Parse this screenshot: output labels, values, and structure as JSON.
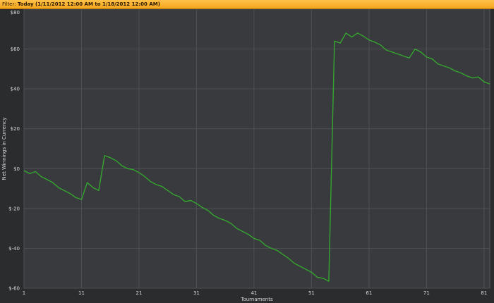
{
  "filter": {
    "label": "Filter:",
    "value": "Today (1/11/2012 12:00 AM to 1/18/2012 12:00 AM)"
  },
  "colors": {
    "plot_bg": "#383a3d",
    "grid": "#4d5054",
    "line": "#35a52f",
    "accent": "#f4a51e"
  },
  "chart_data": {
    "type": "line",
    "title": "",
    "xlabel": "Tournaments",
    "ylabel": "Net Winnings in Currency",
    "xlim": [
      1,
      82
    ],
    "ylim": [
      -60,
      80
    ],
    "x_ticks": [
      1,
      11,
      21,
      31,
      41,
      51,
      61,
      71,
      81
    ],
    "y_ticks": [
      80,
      60,
      40,
      20,
      0,
      -20,
      -40,
      -60
    ],
    "y_tick_labels": [
      "$80",
      "$60",
      "$40",
      "$20",
      "$0",
      "$-20",
      "$-40",
      "$-60"
    ],
    "grid": true,
    "series": [
      {
        "x": [
          1,
          2,
          3,
          4,
          5,
          6,
          7,
          8,
          9,
          10,
          11,
          12,
          13,
          14,
          15,
          16,
          17,
          18,
          19,
          20,
          21,
          22,
          23,
          24,
          25,
          26,
          27,
          28,
          29,
          30,
          31,
          32,
          33,
          34,
          35,
          36,
          37,
          38,
          39,
          40,
          41,
          42,
          43,
          44,
          45,
          46,
          47,
          48,
          49,
          50,
          51,
          52,
          53,
          54,
          55,
          56,
          57,
          58,
          59,
          60,
          61,
          62,
          63,
          64,
          65,
          66,
          67,
          68,
          69,
          70,
          71,
          72,
          73,
          74,
          75,
          76,
          77,
          78,
          79,
          80,
          81,
          82
        ],
        "values": [
          -1,
          -2.5,
          -1.5,
          -4,
          -5.5,
          -7,
          -9.5,
          -11,
          -12.5,
          -14.5,
          -15.5,
          -7,
          -9.5,
          -11,
          6.5,
          5.5,
          4,
          1.5,
          0,
          -0.5,
          -2,
          -4,
          -6.5,
          -8,
          -9,
          -11,
          -13,
          -14,
          -16.5,
          -16,
          -17.5,
          -19.5,
          -21,
          -23.5,
          -25,
          -26,
          -27.5,
          -30,
          -31.5,
          -33,
          -35,
          -36,
          -38.5,
          -40,
          -41,
          -43,
          -45,
          -47.5,
          -49,
          -50.5,
          -52,
          -54.5,
          -55,
          -56.5,
          64,
          63,
          68,
          66,
          68,
          66.5,
          64.5,
          63.5,
          62,
          59.5,
          58.5,
          57.5,
          56.5,
          55.5,
          60,
          58.5,
          56,
          55,
          52.5,
          51.5,
          50.5,
          49,
          48,
          46.5,
          45.5,
          46,
          43.5,
          42.5
        ]
      }
    ]
  }
}
